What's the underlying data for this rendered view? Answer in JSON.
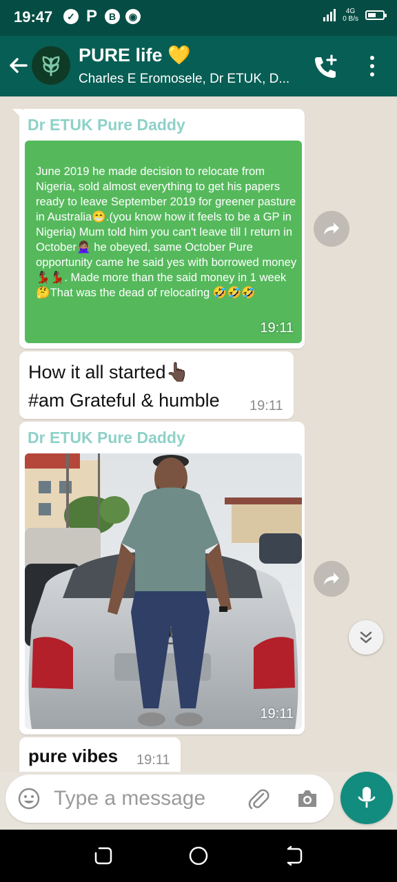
{
  "status_bar": {
    "time": "19:47",
    "network_type": "4G",
    "speed_value": "0",
    "speed_unit": "B/s",
    "battery_level": 0.55
  },
  "header": {
    "title": "PURE life 💛",
    "subtitle": "Charles E Eromosele, Dr ETUK, D..."
  },
  "messages": [
    {
      "sender": "Dr ETUK Pure Daddy",
      "text": "June 2019 he made decision to relocate from Nigeria, sold almost everything to get his papers ready to leave September 2019 for greener pasture in Australia😁.(you know how it feels to be a GP in Nigeria) Mum told him you can't leave till I return in October🙅🏽‍♀️ he obeyed, same October Pure opportunity came he said yes with borrowed money💃🏿💃🏿. Made more than the said money in 1 week 🤔That was the dead of relocating 🤣🤣🤣",
      "time": "19:11"
    },
    {
      "line1": "How it all started👆🏿",
      "line2": "#am Grateful & humble",
      "time": "19:11"
    },
    {
      "sender": "Dr ETUK Pure Daddy",
      "time": "19:11"
    },
    {
      "text": "pure vibes",
      "time": "19:11"
    }
  ],
  "composer": {
    "placeholder": "Type a message"
  },
  "colors": {
    "header": "#075e54",
    "status_bar": "#054d44",
    "accent": "#128c7e",
    "sender_name": "#8ed1c8",
    "text_card": "#55b95c"
  },
  "icons": [
    "back-arrow-icon",
    "group-avatar-icon",
    "add-call-icon",
    "more-vert-icon",
    "forward-icon",
    "chevron-double-down-icon",
    "emoji-icon",
    "attach-icon",
    "camera-icon",
    "mic-icon",
    "recent-apps-icon",
    "home-icon",
    "back-nav-icon"
  ]
}
